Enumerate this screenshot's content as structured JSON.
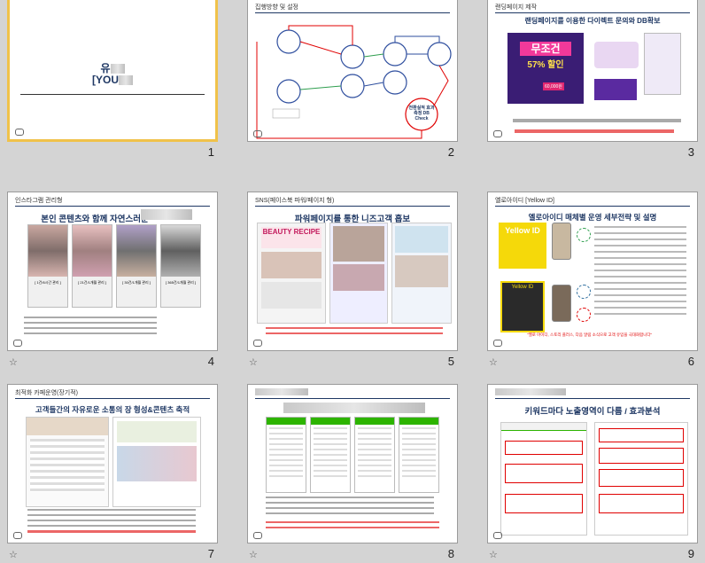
{
  "slides": [
    {
      "number": "1",
      "title_line1": "유",
      "title_line2": "[YOU",
      "selected": true
    },
    {
      "number": "2",
      "header": "집행방향 및 설정",
      "center_label": "전환실적 효과측정 DB Check"
    },
    {
      "number": "3",
      "header": "랜딩페이지 제작",
      "title": "랜딩페이지를 이용한 다이렉트 문의와 DB확보",
      "banner_big": "무조건",
      "banner_sale": "57% 할인",
      "banner_price": "60,000원"
    },
    {
      "number": "4",
      "header": "인스타그램 관리형",
      "title": "본인 콘텐츠와 함께 자연스러운",
      "cards": [
        "[ 1건/6시간 관리 ]",
        "[ 21건/1개월 관리 ]",
        "[ 30건/1개월 관리 ]",
        "[ 365건/1개월 관리 ]"
      ]
    },
    {
      "number": "5",
      "header": "SNS(페이스북 파워/페이지 형)",
      "title": "파워페이지를 통한 니즈고객 흡보",
      "banner": "BEAUTY RECIPE"
    },
    {
      "number": "6",
      "header": "옐로아이디 [Yellow ID]",
      "title": "옐로아이디 매체별 운영 세부전략 및 설명",
      "card_label": "Yellow ID",
      "card_label2": "Yellow ID",
      "footer_note": "\"옐로 아이디, 스토리 플러스, 다음 알림 소식으로 고객 유입을 극대화합니다\""
    },
    {
      "number": "7",
      "header": "최적화 카페운영(장기적)",
      "title": "고객들간의 자유로운 소통의 장 형성&콘텐츠 축적"
    },
    {
      "number": "8",
      "header": ""
    },
    {
      "number": "9",
      "header": "",
      "title": "키워드마다 노출영역이 다름 / 효과분석"
    }
  ],
  "colors": {
    "navy": "#1f3864",
    "red": "#e00000",
    "selected_border": "#f0c24a",
    "background": "#d4d4d4"
  },
  "icons": {
    "star": "☆"
  }
}
